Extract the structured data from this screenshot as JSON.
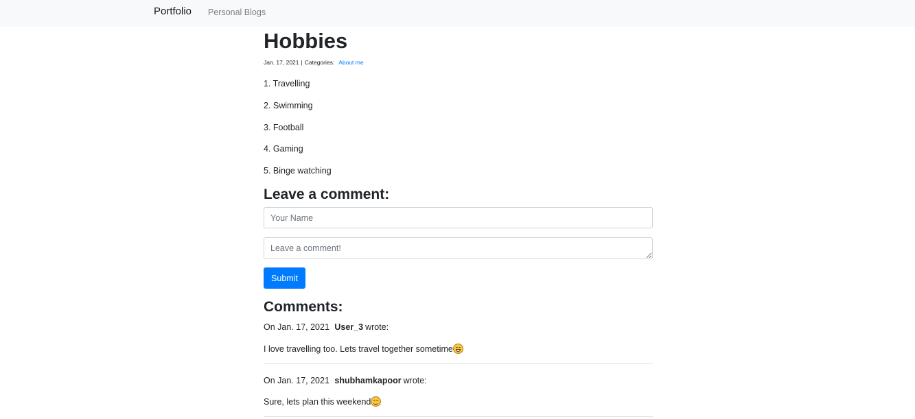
{
  "navbar": {
    "brand": "Portfolio",
    "links": [
      "Personal Blogs"
    ]
  },
  "post": {
    "title": "Hobbies",
    "date": "Jan. 17, 2021",
    "separator": "|",
    "categories_label": "Categories:",
    "category": "About me",
    "lines": [
      "1. Travelling",
      "2. Swimming",
      "3. Football",
      "4. Gaming",
      "5. Binge watching"
    ]
  },
  "comment_form": {
    "heading": "Leave a comment:",
    "name_placeholder": "Your Name",
    "comment_placeholder": "Leave a comment!",
    "submit_label": "Submit"
  },
  "comments": {
    "heading": "Comments:",
    "items": [
      {
        "prefix": "On Jan. 17, 2021",
        "author": "User_3",
        "suffix": "wrote:",
        "text": "I love travelling too. Lets travel together sometime",
        "emoji": "grinning-squinting-face-icon"
      },
      {
        "prefix": "On Jan. 17, 2021",
        "author": "shubhamkapoor",
        "suffix": "wrote:",
        "text": "Sure, lets plan this weekend",
        "emoji": "smiling-face-icon"
      }
    ]
  },
  "colors": {
    "navbar_bg": "#f8f9fa",
    "link": "#007bff",
    "button": "#007bff",
    "text": "#212529"
  }
}
